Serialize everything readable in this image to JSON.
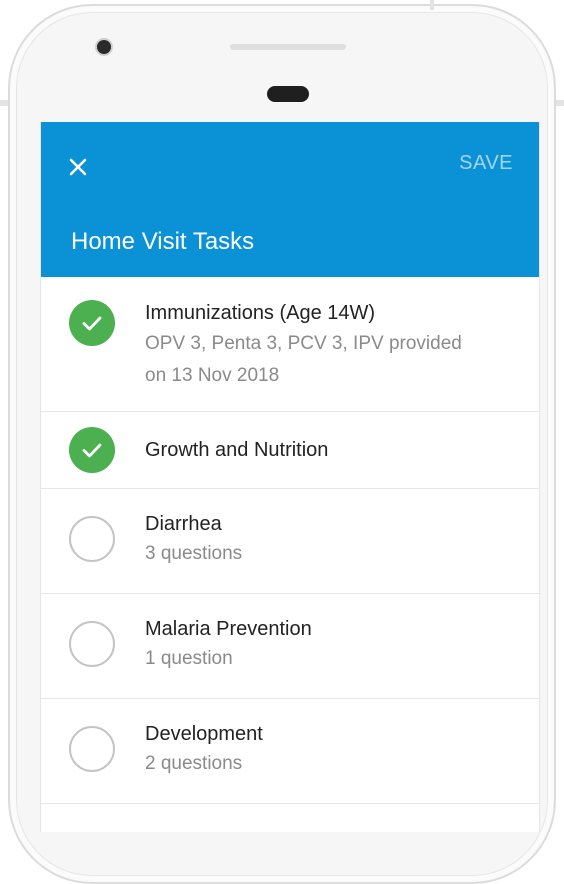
{
  "colors": {
    "appbar": "#0b91d6",
    "check_done": "#4caf50",
    "check_open_border": "#c4c4c4"
  },
  "appbar": {
    "close_icon": "close-icon",
    "save_label": "SAVE",
    "title": "Home Visit Tasks"
  },
  "tasks": [
    {
      "title": "Immunizations (Age 14W)",
      "subtitle_line1": "OPV 3, Penta 3, PCV 3, IPV provided",
      "subtitle_line2": "on 13 Nov 2018",
      "done": true
    },
    {
      "title": "Growth and Nutrition",
      "done": true
    },
    {
      "title": "Diarrhea",
      "subtitle": "3 questions",
      "done": false
    },
    {
      "title": "Malaria Prevention",
      "subtitle": "1 question",
      "done": false
    },
    {
      "title": "Development",
      "subtitle": "2 questions",
      "done": false
    }
  ]
}
